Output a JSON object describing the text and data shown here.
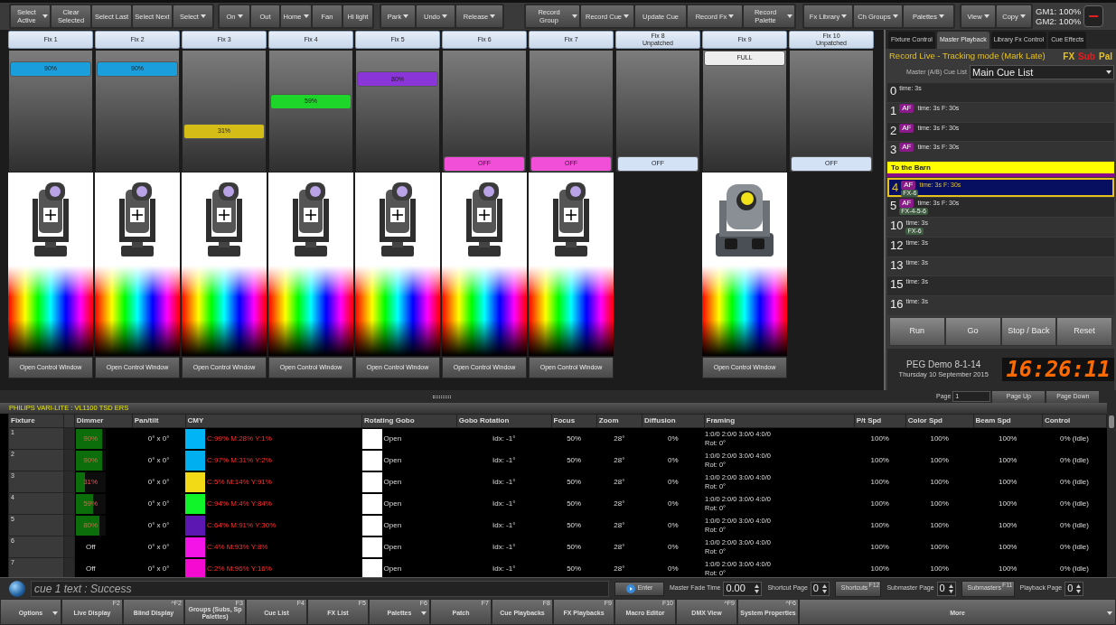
{
  "toolbar": {
    "groups": [
      [
        {
          "label": "Select Active",
          "dropdown": true
        },
        {
          "label": "Clear Selected",
          "dropdown": false
        },
        {
          "label": "Select Last",
          "dropdown": false
        },
        {
          "label": "Select Next",
          "dropdown": false
        },
        {
          "label": "Select",
          "dropdown": true
        }
      ],
      [
        {
          "label": "On",
          "dropdown": true
        },
        {
          "label": "Out",
          "dropdown": false
        },
        {
          "label": "Home",
          "dropdown": true
        },
        {
          "label": "Fan",
          "dropdown": false
        },
        {
          "label": "Hi light",
          "dropdown": false
        }
      ],
      [
        {
          "label": "Park",
          "dropdown": true
        },
        {
          "label": "Undo",
          "dropdown": true
        },
        {
          "label": "Release",
          "dropdown": true
        }
      ],
      [
        {
          "label": "Record Group",
          "dropdown": true
        },
        {
          "label": "Record Cue",
          "dropdown": true
        },
        {
          "label": "Update Cue",
          "dropdown": false
        },
        {
          "label": "Record  Fx",
          "dropdown": true
        },
        {
          "label": "Record Palette",
          "dropdown": true
        }
      ],
      [
        {
          "label": "Fx Library",
          "dropdown": true
        },
        {
          "label": "Ch Groups",
          "dropdown": true
        },
        {
          "label": "Palettes",
          "dropdown": true
        }
      ],
      [
        {
          "label": "View",
          "dropdown": true
        },
        {
          "label": "Copy",
          "dropdown": true
        }
      ]
    ],
    "grand_masters": [
      "GM1: 100%",
      "GM2: 100%"
    ]
  },
  "fixtures": [
    {
      "kind": "profile",
      "name": "Fix 1",
      "fader": {
        "label": "90%",
        "level": 0.9,
        "color": "#1a9fdc"
      },
      "button": "Open Control Window"
    },
    {
      "kind": "profile",
      "name": "Fix 2",
      "fader": {
        "label": "90%",
        "level": 0.9,
        "color": "#1a9fdc"
      },
      "button": "Open Control Window"
    },
    {
      "kind": "profile",
      "name": "Fix 3",
      "fader": {
        "label": "31%",
        "level": 0.31,
        "color": "#d4bd16"
      },
      "button": "Open Control Window"
    },
    {
      "kind": "profile",
      "name": "Fix 4",
      "fader": {
        "label": "59%",
        "level": 0.59,
        "color": "#1ed62a"
      },
      "button": "Open Control Window"
    },
    {
      "kind": "profile",
      "name": "Fix 5",
      "fader": {
        "label": "80%",
        "level": 0.8,
        "color": "#8a35d8"
      },
      "button": "Open Control Window"
    },
    {
      "kind": "profile",
      "name": "Fix 6",
      "fader": {
        "label": "OFF",
        "level": 0,
        "color": "#f24fd8"
      },
      "button": "Open Control Window"
    },
    {
      "kind": "profile",
      "name": "Fix 7",
      "fader": {
        "label": "OFF",
        "level": 0,
        "color": "#f24fd8"
      },
      "button": "Open Control Window"
    },
    {
      "kind": "unpatched",
      "name": "Fix 8",
      "status": "Unpatched",
      "fader": {
        "label": "OFF",
        "level": 0,
        "color": "#d3e2f4"
      }
    },
    {
      "kind": "spot",
      "name": "Fix 9",
      "fader": {
        "label": "FULL",
        "level": 1,
        "color": "#eeeeee"
      },
      "button": "Open Control Window"
    },
    {
      "kind": "unpatched",
      "name": "Fix 10",
      "status": "Unpatched",
      "fader": {
        "label": "OFF",
        "level": 0,
        "color": "#d3e2f4"
      }
    }
  ],
  "playback": {
    "tabs": [
      {
        "label": "Fixture Control",
        "selected": false
      },
      {
        "label": "Master Playback",
        "selected": true
      },
      {
        "label": "Library Fx Control",
        "selected": false
      },
      {
        "label": "Cue Effects",
        "selected": false
      }
    ],
    "mode": "Record Live - Tracking mode (Mark Late)",
    "flags": [
      {
        "label": "FX",
        "color": "#e8c21c"
      },
      {
        "label": "Sub",
        "color": "#e02020"
      },
      {
        "label": "Pal",
        "color": "#e8c21c"
      }
    ],
    "cue_list_label": "Master (A/B) Cue List",
    "cue_list": "Main Cue List",
    "cues": [
      {
        "kind": "cue",
        "number": "0",
        "time": "time: 3s",
        "selected": false
      },
      {
        "kind": "cue",
        "number": "1",
        "badge": "AF",
        "time": "time: 3s F: 30s",
        "selected": false
      },
      {
        "kind": "cue",
        "number": "2",
        "badge": "AF",
        "time": "time: 3s F: 30s",
        "selected": false
      },
      {
        "kind": "cue",
        "number": "3",
        "badge": "AF",
        "time": "time: 3s F: 30s",
        "selected": false
      },
      {
        "kind": "header",
        "title": "To the Barn"
      },
      {
        "kind": "cue",
        "number": "4",
        "badge": "AF",
        "time": "time: 3s F: 30s",
        "fx": "FX-6",
        "selected": true
      },
      {
        "kind": "cue",
        "number": "5",
        "badge": "AF",
        "time": "time: 3s F: 30s",
        "fx": "FX-4-5-6",
        "selected": false
      },
      {
        "kind": "cue",
        "number": "10",
        "time": "time: 3s",
        "fx": "FX-6",
        "selected": false
      },
      {
        "kind": "cue",
        "number": "12",
        "time": "time: 3s",
        "selected": false
      },
      {
        "kind": "cue",
        "number": "13",
        "time": "time: 3s",
        "selected": false
      },
      {
        "kind": "cue",
        "number": "15",
        "time": "time: 3s",
        "selected": false
      },
      {
        "kind": "cue",
        "number": "16",
        "time": "time: 3s",
        "selected": false
      }
    ],
    "buttons": [
      "Run",
      "Go",
      "Stop / Back",
      "Reset"
    ],
    "show": "PEG Demo 8-1-14",
    "date": "Thursday 10 September  2015",
    "clock": "16:26:11",
    "page_label": "Page",
    "page": "1",
    "page_up": "Page Up",
    "page_down": "Page Down"
  },
  "table": {
    "title": "PHILIPS VARI-LITE : VL1100 TSD ERS",
    "columns": [
      "Fixture",
      "Dimmer",
      "Pan/tilt",
      "CMY",
      "Rotating Gobo",
      "Gobo Rotation",
      "Focus",
      "Zoom",
      "Diffusion",
      "Framing",
      "P/t Spd",
      "Color Spd",
      "Beam Spd",
      "Control"
    ],
    "rows": [
      {
        "fixture": "1",
        "dimmer": {
          "label": "90%",
          "level": 0.9
        },
        "pan_tilt": "0° x 0°",
        "cmy": {
          "color": "#00b4f5",
          "text": "C:99% M:28% Y:1%"
        },
        "gobo": "Open",
        "gobo_rotation": "Idx: -1°",
        "focus": "50%",
        "zoom": "28°",
        "diffusion": "0%",
        "framing": [
          "1:0/0 2:0/0 3:0/0 4:0/0",
          "Rot: 0°"
        ],
        "pt_spd": "100%",
        "color_spd": "100%",
        "beam_spd": "100%",
        "control": "0% (Idle)"
      },
      {
        "fixture": "2",
        "dimmer": {
          "label": "90%",
          "level": 0.9
        },
        "pan_tilt": "0° x 0°",
        "cmy": {
          "color": "#00aff0",
          "text": "C:97% M:31% Y:2%"
        },
        "gobo": "Open",
        "gobo_rotation": "Idx: -1°",
        "focus": "50%",
        "zoom": "28°",
        "diffusion": "0%",
        "framing": [
          "1:0/0 2:0/0 3:0/0 4:0/0",
          "Rot: 0°"
        ],
        "pt_spd": "100%",
        "color_spd": "100%",
        "beam_spd": "100%",
        "control": "0% (Idle)"
      },
      {
        "fixture": "3",
        "dimmer": {
          "label": "31%",
          "level": 0.31
        },
        "pan_tilt": "0° x 0°",
        "cmy": {
          "color": "#f2db16",
          "text": "C:5% M:14% Y:91%"
        },
        "gobo": "Open",
        "gobo_rotation": "Idx: -1°",
        "focus": "50%",
        "zoom": "28°",
        "diffusion": "0%",
        "framing": [
          "1:0/0 2:0/0 3:0/0 4:0/0",
          "Rot: 0°"
        ],
        "pt_spd": "100%",
        "color_spd": "100%",
        "beam_spd": "100%",
        "control": "0% (Idle)"
      },
      {
        "fixture": "4",
        "dimmer": {
          "label": "59%",
          "level": 0.59
        },
        "pan_tilt": "0° x 0°",
        "cmy": {
          "color": "#10f52a",
          "text": "C:94% M:4% Y:84%"
        },
        "gobo": "Open",
        "gobo_rotation": "Idx: -1°",
        "focus": "50%",
        "zoom": "28°",
        "diffusion": "0%",
        "framing": [
          "1:0/0 2:0/0 3:0/0 4:0/0",
          "Rot: 0°"
        ],
        "pt_spd": "100%",
        "color_spd": "100%",
        "beam_spd": "100%",
        "control": "0% (Idle)"
      },
      {
        "fixture": "5",
        "dimmer": {
          "label": "80%",
          "level": 0.8
        },
        "pan_tilt": "0° x 0°",
        "cmy": {
          "color": "#5c17b3",
          "text": "C:64% M:91% Y:30%"
        },
        "gobo": "Open",
        "gobo_rotation": "Idx: -1°",
        "focus": "50%",
        "zoom": "28°",
        "diffusion": "0%",
        "framing": [
          "1:0/0 2:0/0 3:0/0 4:0/0",
          "Rot: 0°"
        ],
        "pt_spd": "100%",
        "color_spd": "100%",
        "beam_spd": "100%",
        "control": "0% (Idle)"
      },
      {
        "fixture": "6",
        "dimmer": {
          "label": "Off"
        },
        "pan_tilt": "0° x 0°",
        "cmy": {
          "color": "#f514e8",
          "text": "C:4% M:93% Y:8%"
        },
        "gobo": "Open",
        "gobo_rotation": "Idx: -1°",
        "focus": "50%",
        "zoom": "28°",
        "diffusion": "0%",
        "framing": [
          "1:0/0 2:0/0 3:0/0 4:0/0",
          "Rot: 0°"
        ],
        "pt_spd": "100%",
        "color_spd": "100%",
        "beam_spd": "100%",
        "control": "0% (Idle)"
      },
      {
        "fixture": "7",
        "dimmer": {
          "label": "Off"
        },
        "pan_tilt": "0° x 0°",
        "cmy": {
          "color": "#f50ad2",
          "text": "C:2% M:96% Y:16%"
        },
        "gobo": "Open",
        "gobo_rotation": "Idx: -1°",
        "focus": "50%",
        "zoom": "28°",
        "diffusion": "0%",
        "framing": [
          "1:0/0 2:0/0 3:0/0 4:0/0",
          "Rot: 0°"
        ],
        "pt_spd": "100%",
        "color_spd": "100%",
        "beam_spd": "100%",
        "control": "0% (Idle)"
      }
    ]
  },
  "command": {
    "text": "cue 1 text  : Success",
    "enter": "Enter",
    "fields": [
      {
        "kind": "spin",
        "label": "Master Fade Time",
        "value": "0.00"
      },
      {
        "kind": "spin",
        "label": "Shortcut Page",
        "value": "0"
      },
      {
        "kind": "button",
        "label": "Shortcuts",
        "key": "F12"
      },
      {
        "kind": "spin",
        "label": "Submaster Page",
        "value": "0"
      },
      {
        "kind": "button",
        "label": "Submasters",
        "key": "F11"
      },
      {
        "kind": "spin",
        "label": "Playback Page",
        "value": "0"
      }
    ]
  },
  "function_keys": [
    {
      "label": "Options",
      "dropdown": true
    },
    {
      "label": "Live Display",
      "key": "F2",
      "dropdown": false
    },
    {
      "label": "Blind Display",
      "key": "^F2",
      "dropdown": false
    },
    {
      "label": "Groups (Subs, Sp Palettes)",
      "key": "F3",
      "dropdown": false
    },
    {
      "label": "Cue List",
      "key": "F4",
      "dropdown": false
    },
    {
      "label": "FX List",
      "key": "F5",
      "dropdown": false
    },
    {
      "label": "Palettes",
      "key": "F6",
      "dropdown": true
    },
    {
      "label": "Patch",
      "key": "F7",
      "dropdown": false
    },
    {
      "label": "Cue Playbacks",
      "key": "F8",
      "dropdown": false
    },
    {
      "label": "FX Playbacks",
      "key": "F9",
      "dropdown": false
    },
    {
      "label": "Macro Editor",
      "key": "F10",
      "dropdown": false
    },
    {
      "label": "DMX View",
      "key": "^F9",
      "dropdown": false
    },
    {
      "label": "System Properties",
      "key": "^F6",
      "dropdown": false
    },
    {
      "label": "More",
      "dropdown": true
    }
  ]
}
